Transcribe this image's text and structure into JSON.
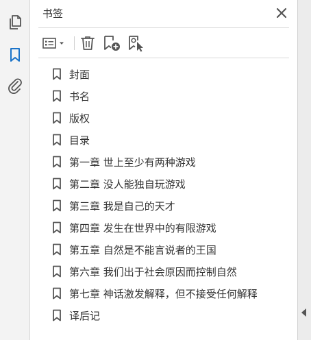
{
  "rail": {
    "items": [
      {
        "name": "pages",
        "icon": "pages-icon",
        "active": false
      },
      {
        "name": "bookmarks",
        "icon": "bookmark-icon",
        "active": true
      },
      {
        "name": "attachments",
        "icon": "paperclip-icon",
        "active": false
      }
    ]
  },
  "panel": {
    "title": "书签",
    "close_icon": "close-icon"
  },
  "toolbar": {
    "buttons": [
      {
        "name": "options",
        "icon": "list-options-icon"
      },
      {
        "name": "delete",
        "icon": "trash-icon"
      },
      {
        "name": "new-bookmark",
        "icon": "bookmark-add-icon"
      },
      {
        "name": "find-current",
        "icon": "bookmark-search-icon"
      }
    ]
  },
  "bookmarks": [
    {
      "label": "封面"
    },
    {
      "label": "书名"
    },
    {
      "label": "版权"
    },
    {
      "label": "目录"
    },
    {
      "label": "第一章  世上至少有两种游戏"
    },
    {
      "label": "第二章  没人能独自玩游戏"
    },
    {
      "label": "第三章  我是自己的天才"
    },
    {
      "label": "第四章  发生在世界中的有限游戏"
    },
    {
      "label": "第五章  自然是不能言说者的王国"
    },
    {
      "label": "第六章  我们出于社会原因而控制自然"
    },
    {
      "label": "第七章  神话激发解释，但不接受任何解释"
    },
    {
      "label": "译后记"
    }
  ],
  "colors": {
    "accent": "#1a73c9",
    "icon": "#555555",
    "text": "#333333"
  }
}
